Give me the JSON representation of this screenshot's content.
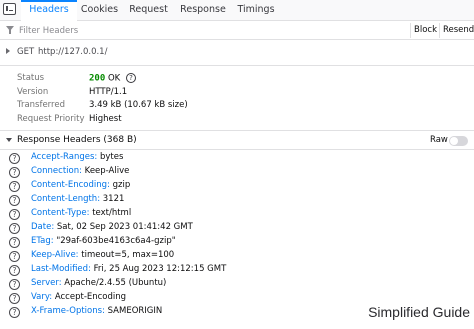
{
  "tabs": [
    {
      "label": "Headers",
      "active": true
    },
    {
      "label": "Cookies",
      "active": false
    },
    {
      "label": "Request",
      "active": false
    },
    {
      "label": "Response",
      "active": false
    },
    {
      "label": "Timings",
      "active": false
    }
  ],
  "filter": {
    "placeholder": "Filter Headers",
    "block_label": "Block",
    "resend_label": "Resend"
  },
  "request": {
    "method": "GET",
    "url": "http://127.0.0.1/"
  },
  "summary": {
    "status_label": "Status",
    "status_code": "200",
    "status_text": "OK",
    "version_label": "Version",
    "version_value": "HTTP/1.1",
    "transferred_label": "Transferred",
    "transferred_value": "3.49 kB (10.67 kB size)",
    "priority_label": "Request Priority",
    "priority_value": "Highest"
  },
  "response_headers": {
    "title": "Response Headers (368 B)",
    "raw_label": "Raw",
    "raw_enabled": false,
    "items": [
      {
        "name": "Accept-Ranges:",
        "value": "bytes"
      },
      {
        "name": "Connection:",
        "value": "Keep-Alive"
      },
      {
        "name": "Content-Encoding:",
        "value": "gzip"
      },
      {
        "name": "Content-Length:",
        "value": "3121"
      },
      {
        "name": "Content-Type:",
        "value": "text/html"
      },
      {
        "name": "Date:",
        "value": "Sat, 02 Sep 2023 01:41:42 GMT"
      },
      {
        "name": "ETag:",
        "value": "\"29af-603be4163c6a4-gzip\""
      },
      {
        "name": "Keep-Alive:",
        "value": "timeout=5, max=100"
      },
      {
        "name": "Last-Modified:",
        "value": "Fri, 25 Aug 2023 12:12:15 GMT"
      },
      {
        "name": "Server:",
        "value": "Apache/2.4.55 (Ubuntu)"
      },
      {
        "name": "Vary:",
        "value": "Accept-Encoding"
      },
      {
        "name": "X-Frame-Options:",
        "value": "SAMEORIGIN"
      }
    ]
  },
  "watermark": "Simplified Guide",
  "colors": {
    "accent": "#0a84ff",
    "header_name": "#0074e8",
    "status_ok": "#058b00"
  },
  "icons": {
    "panel": "panel-icon",
    "filter": "filter-icon",
    "help": "help-icon",
    "expand": "chevron-right-icon",
    "collapse": "chevron-down-icon"
  }
}
